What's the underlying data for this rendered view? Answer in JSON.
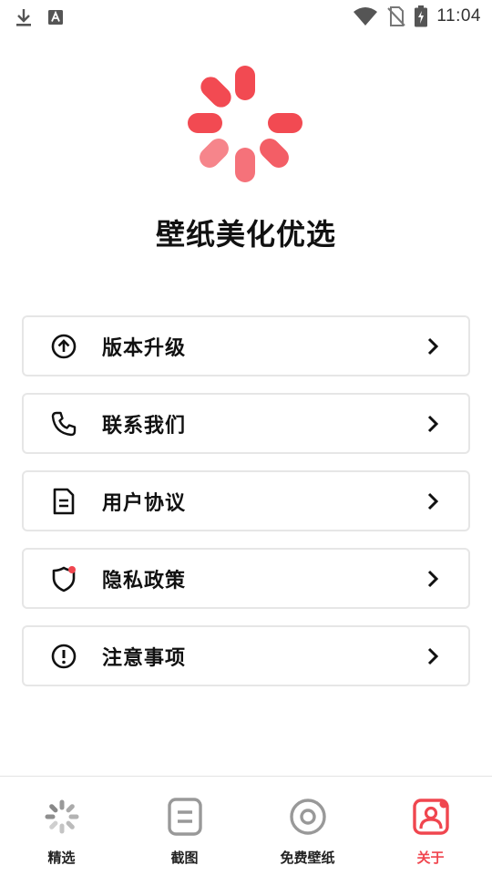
{
  "status_bar": {
    "time": "11:04",
    "icons": [
      "download-icon",
      "font-a-icon",
      "wifi-icon",
      "no-sim-icon",
      "battery-charging-icon"
    ]
  },
  "app": {
    "title": "壁纸美化优选",
    "logo_icon": "spinner-logo-icon",
    "accent_color": "#f24a52"
  },
  "menu": {
    "items": [
      {
        "label": "版本升级",
        "icon": "arrow-up-circle-icon"
      },
      {
        "label": "联系我们",
        "icon": "phone-icon"
      },
      {
        "label": "用户协议",
        "icon": "document-icon"
      },
      {
        "label": "隐私政策",
        "icon": "shield-icon"
      },
      {
        "label": "注意事项",
        "icon": "alert-circle-icon"
      }
    ]
  },
  "bottom_nav": {
    "items": [
      {
        "label": "精选",
        "icon": "spinner-icon",
        "active": false
      },
      {
        "label": "截图",
        "icon": "list-box-icon",
        "active": false
      },
      {
        "label": "免费壁纸",
        "icon": "disc-icon",
        "active": false
      },
      {
        "label": "关于",
        "icon": "profile-icon",
        "active": true
      }
    ],
    "active_color": "#f0464f"
  }
}
